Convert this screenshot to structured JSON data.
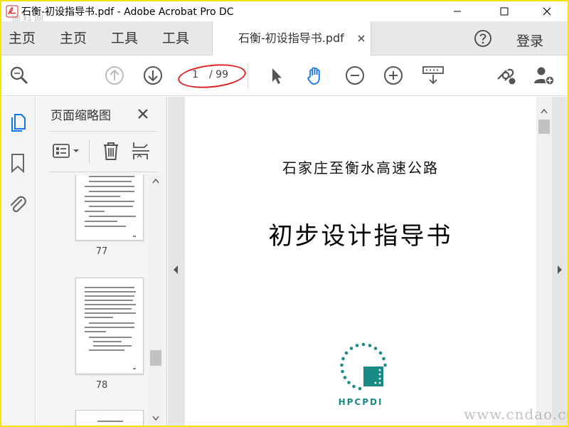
{
  "window": {
    "title": "石衡-初设指导书.pdf - Adobe Acrobat Pro DC",
    "watermark_top": "迪科网"
  },
  "tabs": {
    "home1": "主页",
    "home2": "主页",
    "tools1": "工具",
    "tools2": "工具",
    "document_tab": "石衡-初设指导书.pdf",
    "login": "登录"
  },
  "toolbar": {
    "current_page": "1",
    "total_pages": "/ 99"
  },
  "thumbnails": {
    "panel_title": "页面缩略图",
    "pages": [
      {
        "label": "77"
      },
      {
        "label": "78"
      }
    ]
  },
  "document": {
    "subtitle": "石家庄至衡水高速公路",
    "title": "初步设计指导书",
    "logo_text": "HPCPDI"
  },
  "watermark_bottom": "www.cndao.com",
  "colors": {
    "accent_blue": "#1473e6",
    "annotation_red": "#e02222",
    "logo_teal": "#1a8a86",
    "frame_yellow": "#f2e600"
  }
}
